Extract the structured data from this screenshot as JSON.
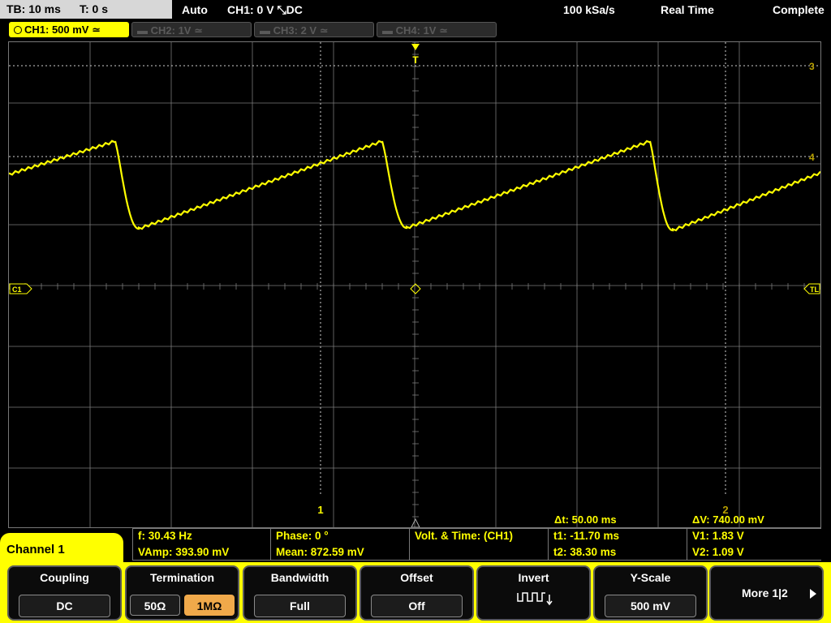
{
  "topbar": {
    "timebase": "TB: 10 ms",
    "trigger_time": "T: 0 s",
    "trigger_mode": "Auto",
    "trigger_info": "CH1: 0 V ⤡DC",
    "sample_rate": "100 kSa/s",
    "acq_mode": "Real Time",
    "status": "Complete"
  },
  "channels": [
    {
      "label": "CH1: 500 mV ≃",
      "active": true,
      "color": "#ffff00"
    },
    {
      "label": "CH2: 1V ≃",
      "active": false
    },
    {
      "label": "CH3: 2 V ≃",
      "active": false
    },
    {
      "label": "CH4: 1V ≃",
      "active": false
    }
  ],
  "plot": {
    "ch1_marker": "C1",
    "trigger_marker": "T",
    "trigger_level_marker": "TL",
    "cursor_labels": {
      "h1": "3",
      "h2": "4",
      "v1": "1",
      "v2": "2"
    },
    "delta_t": "Δt: 50.00 ms",
    "delta_v": "ΔV: 740.00 mV",
    "waveform_color": "#ffff00",
    "grid_color": "#7a7a7a"
  },
  "measurements": {
    "row1": [
      "f: 30.43 Hz",
      "Phase: 0 °",
      "Volt. & Time:  (CH1)",
      "t1: -11.70 ms",
      "V1: 1.83 V"
    ],
    "row2": [
      "VAmp: 393.90 mV",
      "Mean: 872.59 mV",
      "",
      "t2: 38.30 ms",
      "V2: 1.09 V"
    ]
  },
  "softkeys": {
    "menu_title": "Channel 1",
    "coupling": {
      "title": "Coupling",
      "value": "DC"
    },
    "termination": {
      "title": "Termination",
      "options": [
        "50Ω",
        "1MΩ"
      ],
      "selected": "1MΩ"
    },
    "bandwidth": {
      "title": "Bandwidth",
      "value": "Full"
    },
    "offset": {
      "title": "Offset",
      "value": "Off"
    },
    "invert": {
      "title": "Invert",
      "icon": "invert-waveform-icon"
    },
    "yscale": {
      "title": "Y-Scale",
      "value": "500 mV"
    },
    "more": {
      "label": "More 1|2",
      "icon": "arrow-right-icon"
    }
  }
}
